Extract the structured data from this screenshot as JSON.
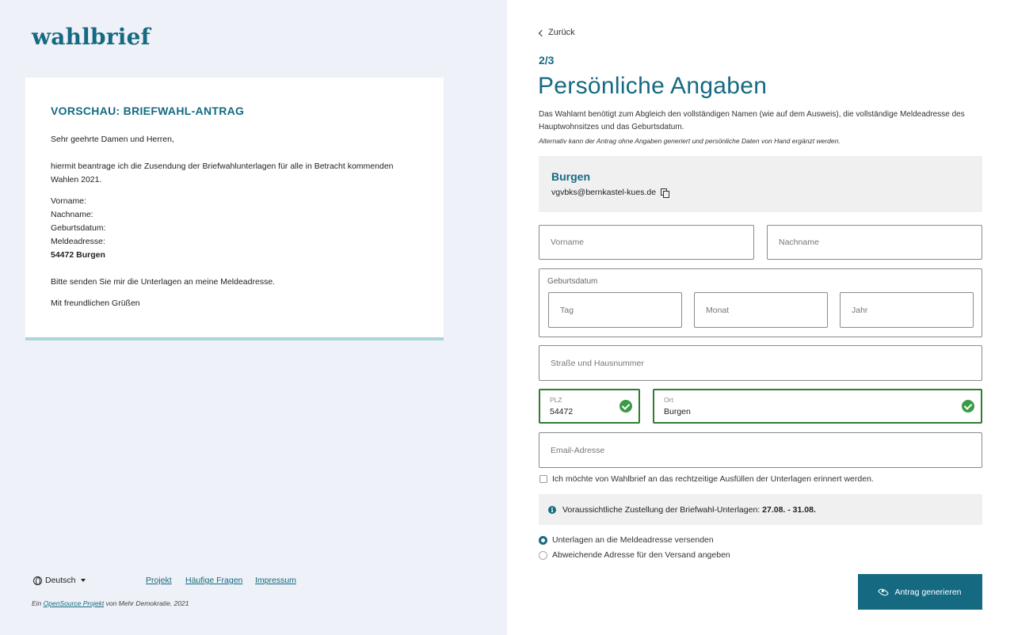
{
  "brand": {
    "logo": "wahlbrief",
    "accent": "#156a82",
    "valid_color": "#3a9b47"
  },
  "preview": {
    "title": "VORSCHAU: BRIEFWAHL-ANTRAG",
    "greeting": "Sehr geehrte Damen und Herren,",
    "body_line1": "hiermit beantrage ich die Zusendung der Briefwahlunterlagen für alle in Betracht kommenden",
    "body_line2": "Wahlen 2021.",
    "label_vorname": "Vorname:",
    "label_nachname": "Nachname:",
    "label_geburtsdatum": "Geburtsdatum:",
    "label_meldeadresse": "Meldeadresse:",
    "address": "54472 Burgen",
    "request": "Bitte senden Sie mir die Unterlagen an meine Meldeadresse.",
    "closing": "Mit freundlichen Grüßen"
  },
  "footer": {
    "language": "Deutsch",
    "links": [
      "Projekt",
      "Häufige Fragen",
      "Impressum"
    ],
    "note_prefix": "Ein ",
    "note_link": "OpenSource Projekt",
    "note_suffix": " von Mehr Demokratie. 2021"
  },
  "form": {
    "back": "Zurück",
    "step": "2/3",
    "heading": "Persönliche Angaben",
    "description": "Das Wahlamt benötigt zum Abgleich den vollständigen Namen (wie auf dem Ausweis), die vollständige Meldeadresse des Hauptwohnsitzes und das Geburtsdatum.",
    "alternative": "Alternativ kann der Antrag ohne Angaben generiert und persönliche Daten von Hand ergänzt werden.",
    "office_name": "Burgen",
    "office_email": "vgvbks@bernkastel-kues.de",
    "placeholders": {
      "vorname": "Vorname",
      "nachname": "Nachname",
      "tag": "Tag",
      "monat": "Monat",
      "jahr": "Jahr",
      "strasse": "Straße und Hausnummer",
      "email": "Email-Adresse"
    },
    "birthdate_label": "Geburtsdatum",
    "plz_label": "PLZ",
    "plz_value": "54472",
    "ort_label": "Ort",
    "ort_value": "Burgen",
    "reminder": "Ich möchte von Wahlbrief an das rechtzeitige Ausfüllen der Unterlagen erinnert werden.",
    "info_text": "Voraussichtliche Zustellung der Briefwahl-Unterlagen: ",
    "info_dates": "27.08. - 31.08.",
    "radio_options": [
      {
        "label": "Unterlagen an die Meldeadresse versenden",
        "selected": true
      },
      {
        "label": "Abweichende Adresse für den Versand angeben",
        "selected": false
      }
    ],
    "submit": "Antrag generieren"
  }
}
